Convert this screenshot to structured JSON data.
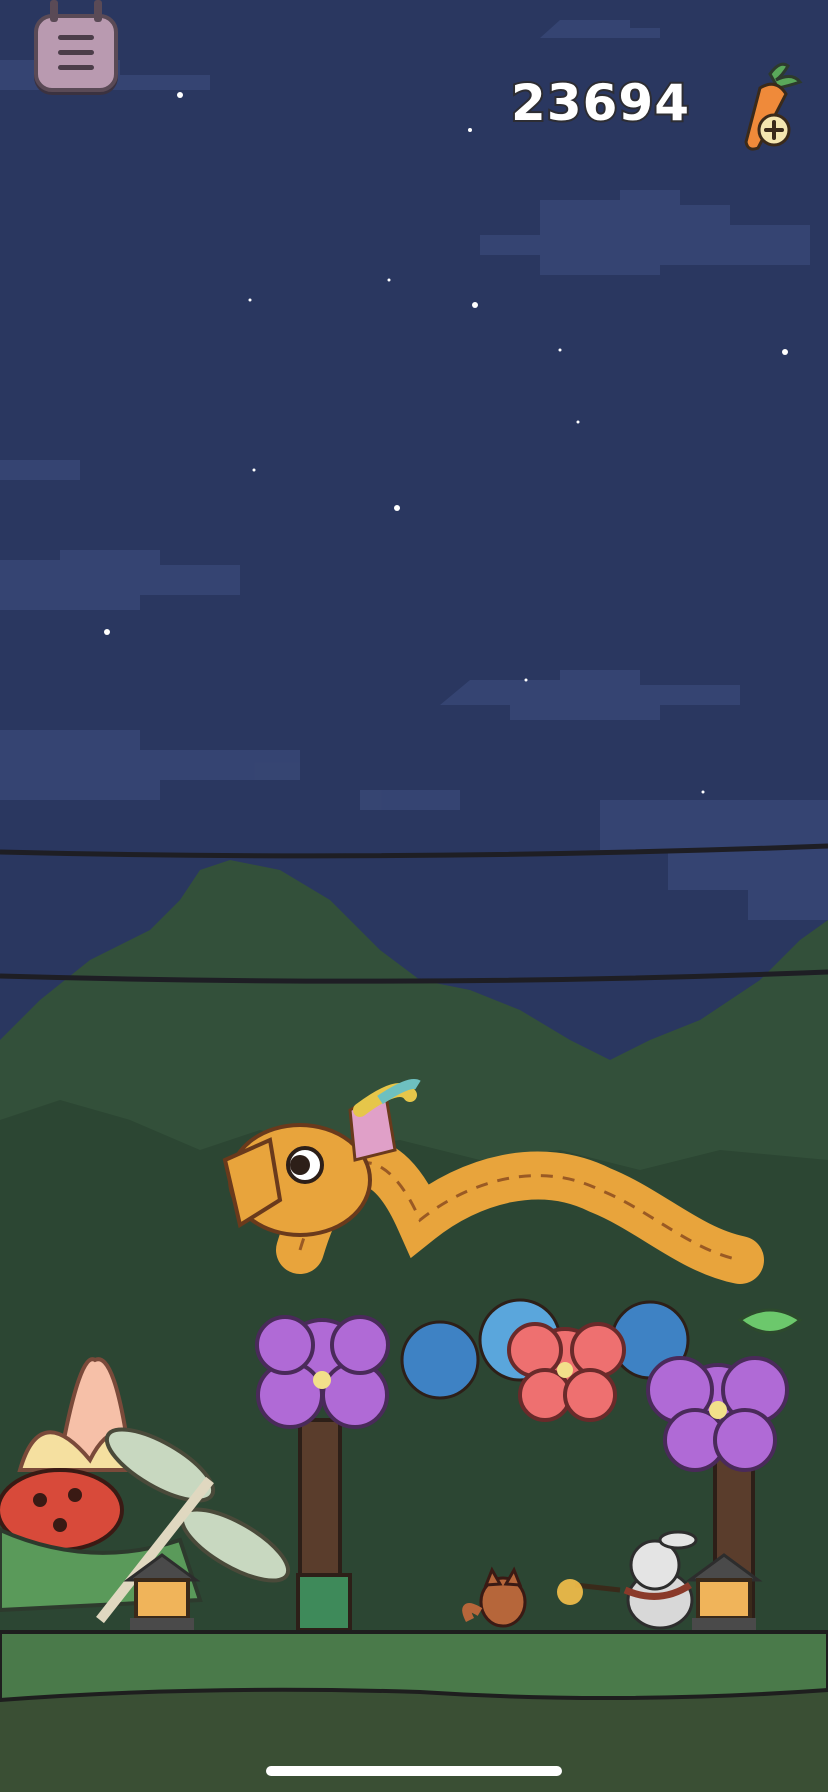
{
  "hud": {
    "carrot_count": "23694",
    "menu_icon": "hamburger-menu-icon",
    "add_carrots_icon": "carrot-plus-icon"
  },
  "scene": {
    "sky_color": "#2a3760",
    "tree_color": "#33503a",
    "ground_color": "#3a4f34"
  }
}
